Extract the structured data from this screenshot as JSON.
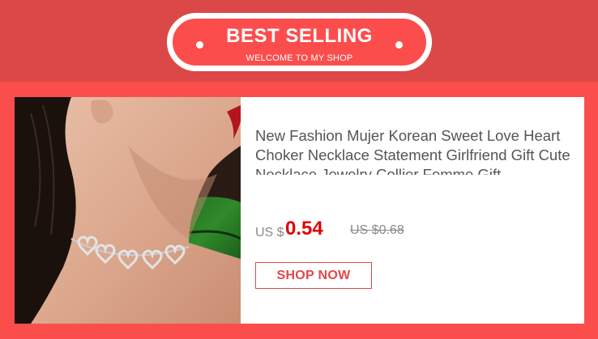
{
  "banner": {
    "title": "BEST SELLING",
    "subtitle": "WELCOME TO MY SHOP"
  },
  "product": {
    "title": "New Fashion Mujer Korean Sweet Love Heart Choker Necklace Statement Girlfriend Gift Cute Necklace Jewelry Collier Femme Gift",
    "currency_label": "US $",
    "price": "0.54",
    "original_price": "US $0.68",
    "cta_label": "SHOP NOW"
  },
  "colors": {
    "background": "#fc4d4d",
    "header_band": "#dc4848",
    "price": "#e00000",
    "button_accent": "#e14848"
  }
}
